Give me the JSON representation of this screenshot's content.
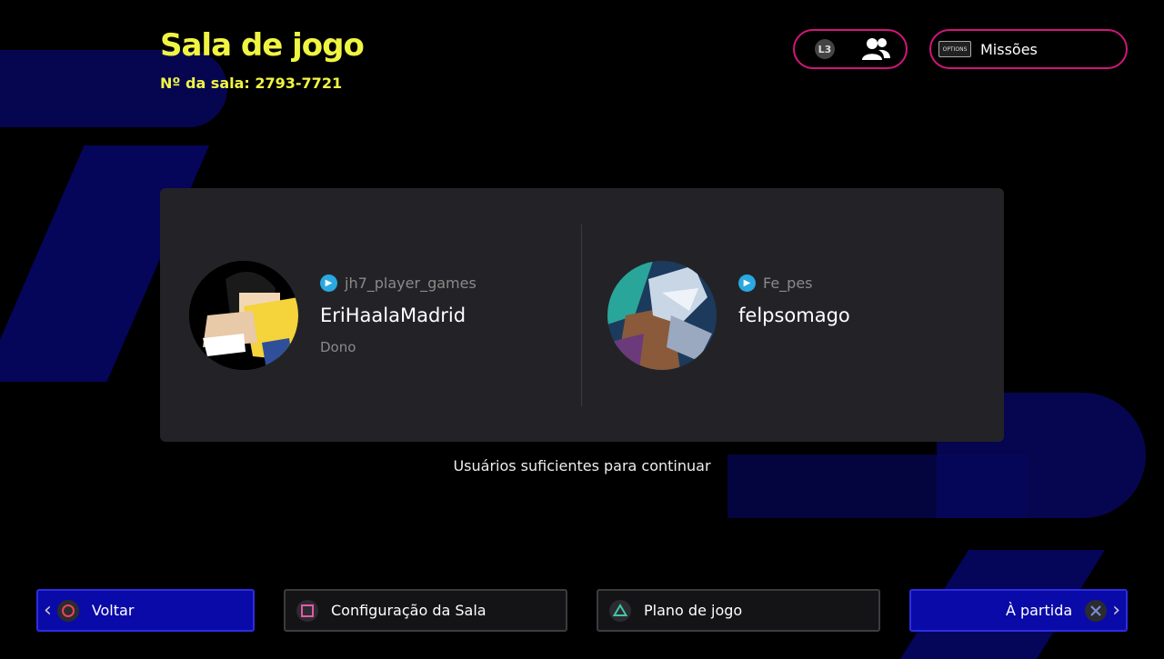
{
  "header": {
    "title": "Sala de jogo",
    "room_number": "Nº da sala: 2793-7721"
  },
  "top_actions": {
    "friends_button": {
      "key_hint": "L3",
      "icon": "friends-icon"
    },
    "missions_button": {
      "key_hint": "OPTIONS",
      "label": "Missões"
    }
  },
  "players": [
    {
      "psn_id": "jh7_player_games",
      "name": "EriHaalaMadrid",
      "role": "Dono"
    },
    {
      "psn_id": "Fe_pes",
      "name": "felpsomago",
      "role": ""
    }
  ],
  "status_text": "Usuários suficientes para continuar",
  "footer": {
    "back": {
      "label": "Voltar",
      "button_symbol": "circle"
    },
    "room_settings": {
      "label": "Configuração da Sala",
      "button_symbol": "square"
    },
    "game_plan": {
      "label": "Plano de jogo",
      "button_symbol": "triangle"
    },
    "to_match": {
      "label": "À partida",
      "button_symbol": "cross"
    }
  },
  "colors": {
    "accent_yellow": "#f0f542",
    "pill_border": "#d1167a",
    "primary_blue": "#0a0aa8"
  }
}
